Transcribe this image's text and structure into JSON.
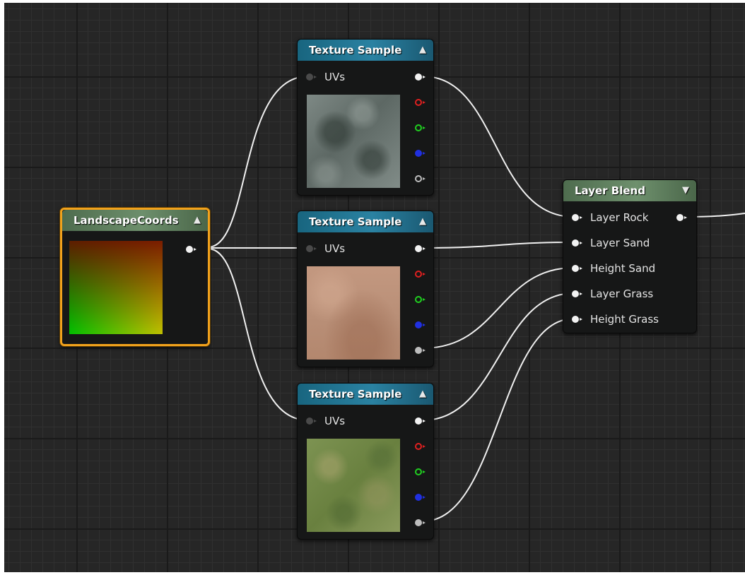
{
  "graph": {
    "wire_color": "#f0f0f0",
    "selection_color": "#f2a21c"
  },
  "nodes": {
    "landscape_coords": {
      "title": "LandscapeCoords",
      "collapse_icon": "collapse-up-arrow"
    },
    "texture_rock": {
      "title": "Texture Sample",
      "input_uvs": "UVs",
      "preview": "rock texture",
      "collapse_icon": "collapse-up-arrow"
    },
    "texture_sand": {
      "title": "Texture Sample",
      "input_uvs": "UVs",
      "preview": "sand texture",
      "collapse_icon": "collapse-up-arrow"
    },
    "texture_grass": {
      "title": "Texture Sample",
      "input_uvs": "UVs",
      "preview": "grass texture",
      "collapse_icon": "collapse-up-arrow"
    },
    "layer_blend": {
      "title": "Layer Blend",
      "collapse_icon": "expand-down-arrow",
      "inputs": [
        "Layer Rock",
        "Layer Sand",
        "Height Sand",
        "Layer Grass",
        "Height Grass"
      ]
    }
  },
  "pin_colors": {
    "rgb": "#f2f2f2",
    "r": "#e02020",
    "g": "#20d020",
    "b": "#2030e0",
    "a": "#bdbdbd",
    "disconnected": "#4a4a4a"
  }
}
